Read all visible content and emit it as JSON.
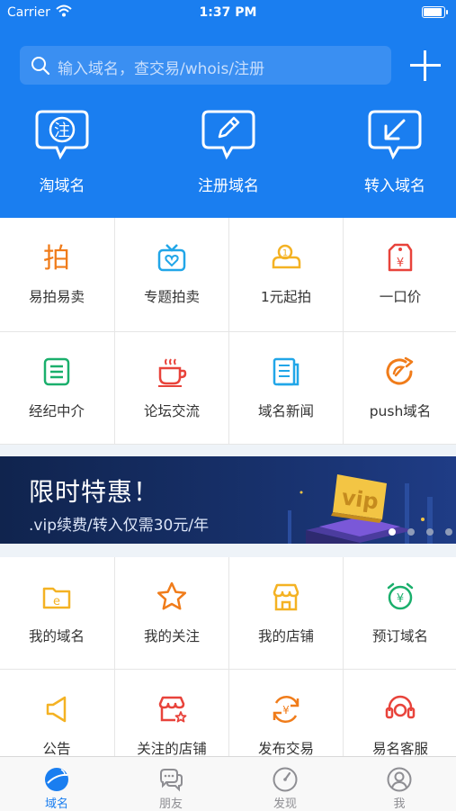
{
  "status_bar": {
    "carrier": "Carrier",
    "time": "1:37 PM",
    "battery": 1.0
  },
  "search": {
    "placeholder": "输入域名，查交易/whois/注册"
  },
  "quick_actions": [
    {
      "label": "淘域名",
      "icon": "tao-icon"
    },
    {
      "label": "注册域名",
      "icon": "edit-icon"
    },
    {
      "label": "转入域名",
      "icon": "transfer-in-icon"
    }
  ],
  "services": [
    {
      "label": "易拍易卖",
      "icon": "auction-icon",
      "color": "#f07c1a"
    },
    {
      "label": "专题拍卖",
      "icon": "heart-box-icon",
      "color": "#21a6e8"
    },
    {
      "label": "1元起拍",
      "icon": "coin-icon",
      "color": "#f4b223"
    },
    {
      "label": "一口价",
      "icon": "price-tag-icon",
      "color": "#e8433b"
    },
    {
      "label": "经纪中介",
      "icon": "list-icon",
      "color": "#1aaf6c"
    },
    {
      "label": "论坛交流",
      "icon": "coffee-cup-icon",
      "color": "#e8433b"
    },
    {
      "label": "域名新闻",
      "icon": "news-icon",
      "color": "#21a6e8"
    },
    {
      "label": "push域名",
      "icon": "push-icon",
      "color": "#f07c1a"
    }
  ],
  "banner": {
    "title": "限时特惠！",
    "subtitle": ".vip续费/转入仅需30元/年",
    "slides": 4,
    "active_slide": 1
  },
  "my_items": [
    {
      "label": "我的域名",
      "icon": "folder-e-icon",
      "color": "#f4b223"
    },
    {
      "label": "我的关注",
      "icon": "star-icon",
      "color": "#f07c1a"
    },
    {
      "label": "我的店铺",
      "icon": "shop-icon",
      "color": "#f4b223"
    },
    {
      "label": "预订域名",
      "icon": "alarm-yen-icon",
      "color": "#1aaf6c"
    },
    {
      "label": "公告",
      "icon": "megaphone-icon",
      "color": "#f4b223"
    },
    {
      "label": "关注的店铺",
      "icon": "shop-star-icon",
      "color": "#e8433b"
    },
    {
      "label": "发布交易",
      "icon": "yen-cycle-icon",
      "color": "#f07c1a"
    },
    {
      "label": "易名客服",
      "icon": "headset-icon",
      "color": "#e8433b"
    }
  ],
  "tabs": [
    {
      "label": "域名",
      "icon": "globe-icon",
      "active": true
    },
    {
      "label": "朋友",
      "icon": "chat-bubbles-icon",
      "active": false
    },
    {
      "label": "发现",
      "icon": "compass-icon",
      "active": false
    },
    {
      "label": "我",
      "icon": "user-icon",
      "active": false
    }
  ],
  "colors": {
    "brand_blue": "#1a7ef0",
    "banner_bg": "#15306a"
  }
}
